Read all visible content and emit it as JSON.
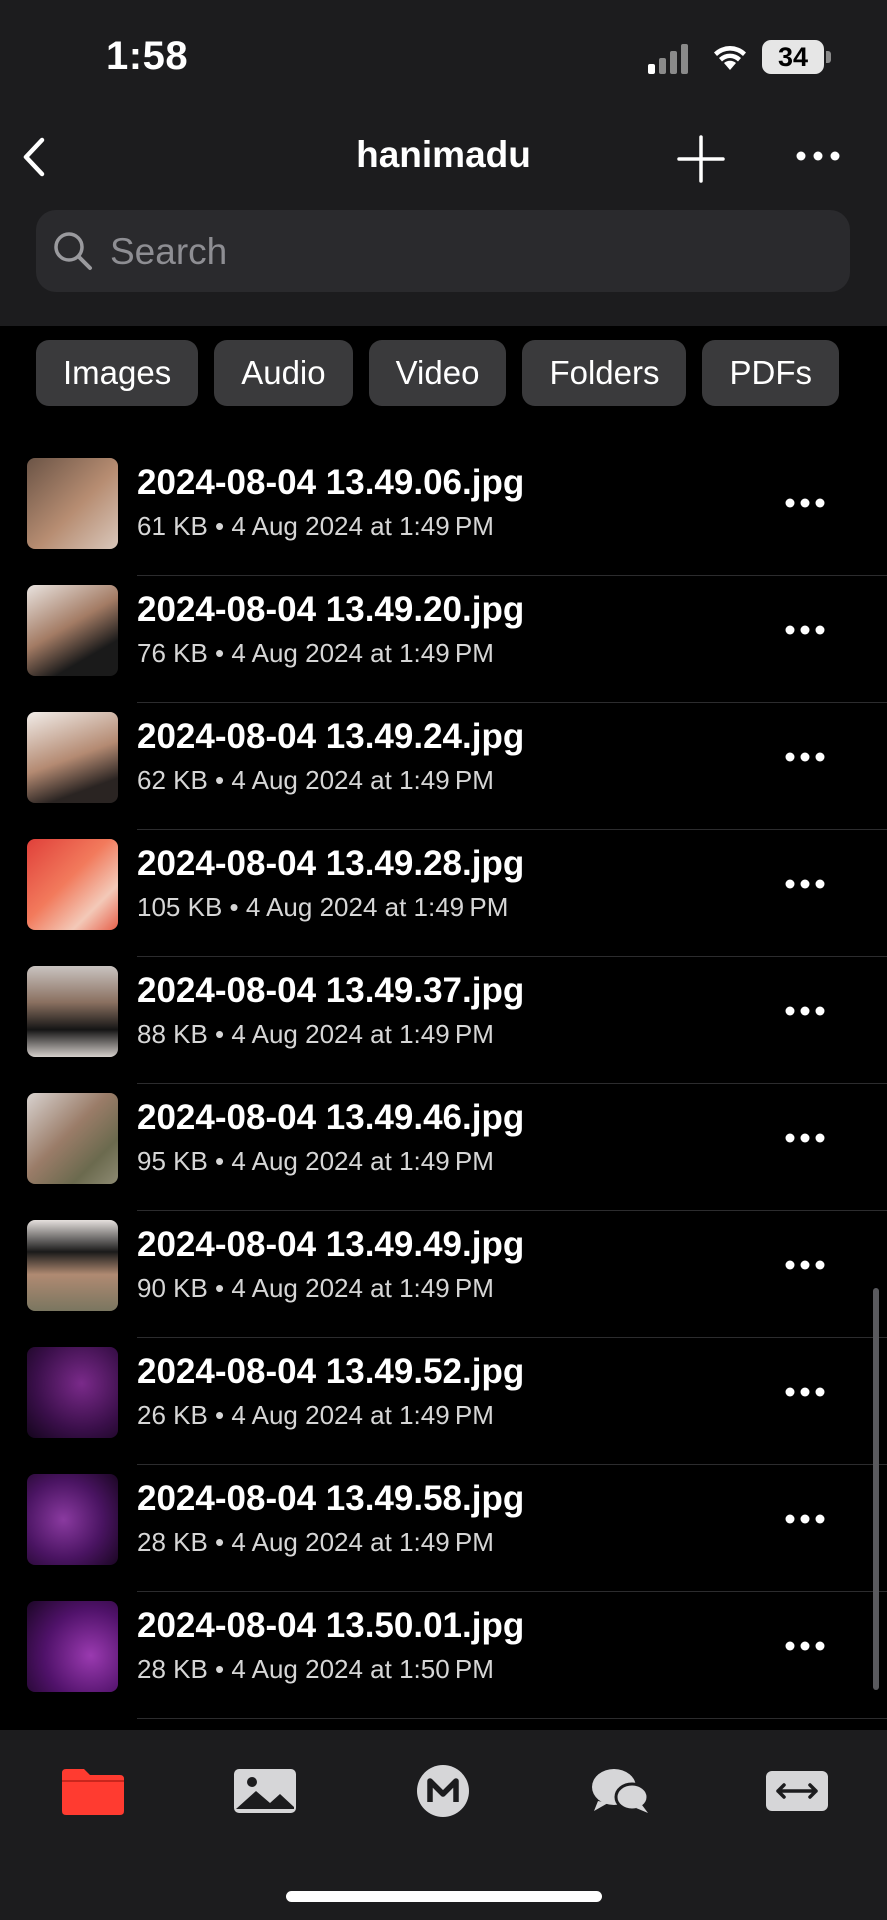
{
  "status": {
    "time": "1:58",
    "battery": "34"
  },
  "header": {
    "title": "hanimadu"
  },
  "search": {
    "placeholder": "Search"
  },
  "filters": [
    "Images",
    "Audio",
    "Video",
    "Folders",
    "PDFs"
  ],
  "files": [
    {
      "name": "2024-08-04 13.49.06.jpg",
      "meta": "61 KB • 4 Aug 2024 at 1:49 PM"
    },
    {
      "name": "2024-08-04 13.49.20.jpg",
      "meta": "76 KB • 4 Aug 2024 at 1:49 PM"
    },
    {
      "name": "2024-08-04 13.49.24.jpg",
      "meta": "62 KB • 4 Aug 2024 at 1:49 PM"
    },
    {
      "name": "2024-08-04 13.49.28.jpg",
      "meta": "105 KB • 4 Aug 2024 at 1:49 PM"
    },
    {
      "name": "2024-08-04 13.49.37.jpg",
      "meta": "88 KB • 4 Aug 2024 at 1:49 PM"
    },
    {
      "name": "2024-08-04 13.49.46.jpg",
      "meta": "95 KB • 4 Aug 2024 at 1:49 PM"
    },
    {
      "name": "2024-08-04 13.49.49.jpg",
      "meta": "90 KB • 4 Aug 2024 at 1:49 PM"
    },
    {
      "name": "2024-08-04 13.49.52.jpg",
      "meta": "26 KB • 4 Aug 2024 at 1:49 PM"
    },
    {
      "name": "2024-08-04 13.49.58.jpg",
      "meta": "28 KB • 4 Aug 2024 at 1:49 PM"
    },
    {
      "name": "2024-08-04 13.50.01.jpg",
      "meta": "28 KB • 4 Aug 2024 at 1:50 PM"
    }
  ],
  "tabs": [
    {
      "icon": "folder-icon",
      "active": true
    },
    {
      "icon": "photo-icon",
      "active": false
    },
    {
      "icon": "m-logo-icon",
      "active": false
    },
    {
      "icon": "chat-bubbles-icon",
      "active": false
    },
    {
      "icon": "transfer-icon",
      "active": false
    }
  ],
  "colors": {
    "accent": "#ff3b30",
    "background": "#000000",
    "bar": "#1c1c1e",
    "chip": "#3a3a3c"
  }
}
